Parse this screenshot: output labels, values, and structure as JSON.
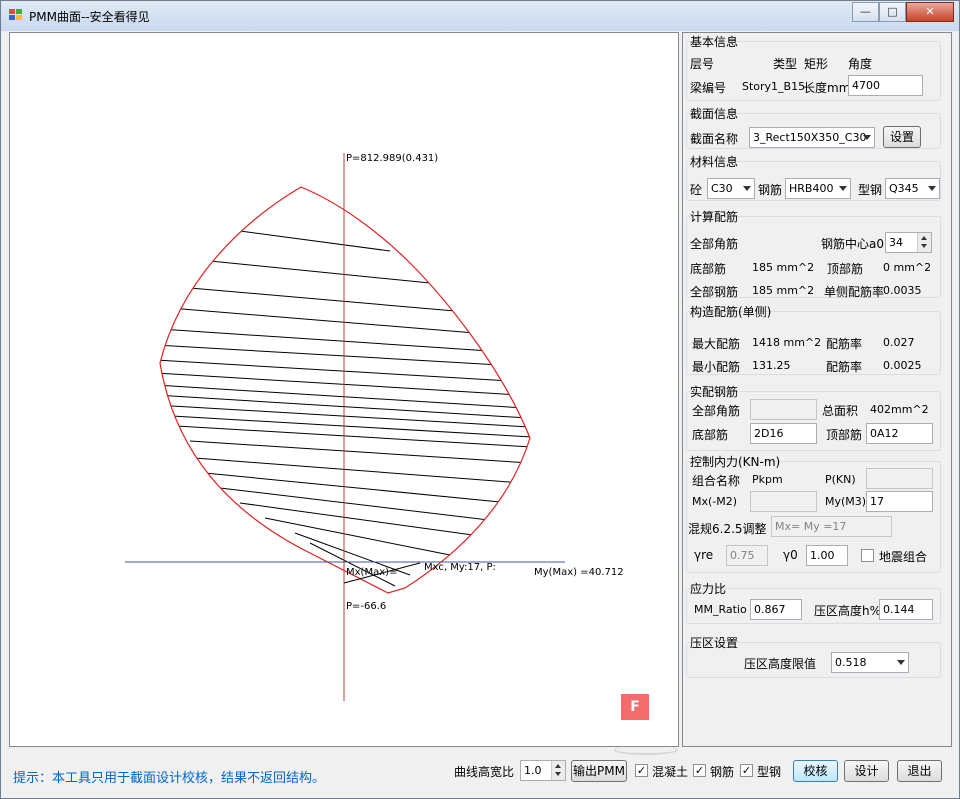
{
  "window": {
    "title": "PMM曲面--安全看得见",
    "controls": {
      "minimize": "—",
      "restore": "□",
      "close": "✕"
    }
  },
  "plot": {
    "p_max_label": "P=812.989(0.431)",
    "p_min_label": "P=-66.6",
    "mx_max_label": "Mx(Max)=",
    "my_max_label": "My(Max) =40.712",
    "point_label": "Mxc, My:17, P:",
    "curve_color": "#e02020",
    "fill_color": "#000000",
    "axis_h_color": "#3a55a8",
    "axis_v_color": "#b04040",
    "logo": "F"
  },
  "basic": {
    "title": "基本信息",
    "floor_label": "层号",
    "type_label": "类型",
    "type_value": "矩形",
    "angle_label": "角度",
    "beam_label": "梁编号",
    "beam_value": "Story1_B15",
    "length_label": "长度mm",
    "length_value": "4700"
  },
  "section": {
    "title": "截面信息",
    "name_label": "截面名称",
    "name_value": "3_Rect150X350_C30",
    "settings_button": "设置"
  },
  "material": {
    "title": "材料信息",
    "concrete_label": "砼",
    "concrete_value": "C30",
    "rebar_label": "钢筋",
    "rebar_value": "HRB400",
    "steel_label": "型钢",
    "steel_value": "Q345"
  },
  "calc": {
    "title": "计算配筋",
    "corner_label": "全部角筋",
    "cover_label": "钢筋中心a0",
    "cover_value": "34",
    "bottom_label": "底部筋",
    "bottom_value": "185 mm^2",
    "top_label": "顶部筋",
    "top_value": "0 mm^2",
    "all_label": "全部钢筋",
    "all_value": "185 mm^2",
    "ratio_label": "单侧配筋率",
    "ratio_value": "0.0035"
  },
  "construct": {
    "title": "构造配筋(单侧)",
    "max_label": "最大配筋",
    "max_value": "1418 mm^2",
    "max_ratio_label": "配筋率",
    "max_ratio_value": "0.027",
    "min_label": "最小配筋",
    "min_value": "131.25",
    "min_ratio_label": "配筋率",
    "min_ratio_value": "0.0025"
  },
  "actual": {
    "title": "实配钢筋",
    "corner_label": "全部角筋",
    "corner_value": "",
    "total_label": "总面积",
    "total_value": "402mm^2",
    "bottom_label": "底部筋",
    "bottom_value": "2D16",
    "top_label": "顶部筋",
    "top_value": "0A12"
  },
  "force": {
    "title": "控制内力(KN-m)",
    "combo_label": "组合名称",
    "combo_value": "Pkpm",
    "p_label": "P(KN)",
    "p_value": "",
    "mx_label": "Mx(-M2)",
    "mx_value": "",
    "my_label": "My(M3)",
    "my_value": "17",
    "adjust_label": "混规6.2.5调整",
    "adjust_value": "Mx= My =17",
    "yre_label": "γre",
    "yre_value": "0.75",
    "y0_label": "γ0",
    "y0_value": "1.00",
    "seismic_label": "地震组合"
  },
  "stress": {
    "title": "应力比",
    "mm_label": "MM_Ratio",
    "mm_value": "0.867",
    "zone_label": "压区高度h%",
    "zone_value": "0.144"
  },
  "zone": {
    "title": "压区设置",
    "limit_label": "压区高度限值",
    "limit_value": "0.518"
  },
  "bottom": {
    "hint": "提示：本工具只用于截面设计校核，结果不返回结构。",
    "ratio_label": "曲线高宽比",
    "ratio_value": "1.0",
    "export_button": "输出PMM",
    "concrete_label": "混凝土",
    "rebar_label": "钢筋",
    "steel_label": "型钢",
    "check_button": "校核",
    "design_button": "设计",
    "exit_button": "退出"
  }
}
